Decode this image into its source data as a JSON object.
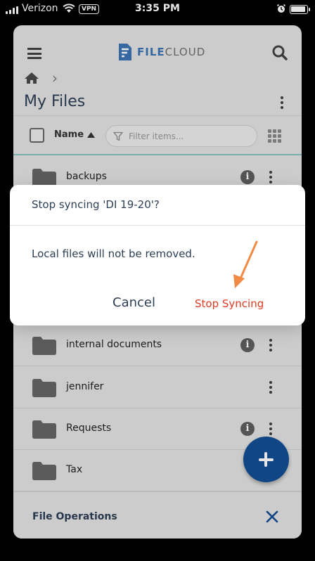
{
  "status_bar": {
    "carrier": "Verizon",
    "vpn": "VPN",
    "time": "3:35 PM"
  },
  "header": {
    "logo_prefix": "FILE",
    "logo_suffix": "CLOUD"
  },
  "breadcrumb": {
    "separator": "›"
  },
  "page_title": "My Files",
  "list_header": {
    "name_label": "Name",
    "filter_placeholder": "Filter items..."
  },
  "files": [
    {
      "name": "backups",
      "has_info": true
    },
    {
      "name": "internal documents",
      "has_info": true
    },
    {
      "name": "jennifer",
      "has_info": false
    },
    {
      "name": "Requests",
      "has_info": true
    },
    {
      "name": "Tax",
      "has_info": false
    }
  ],
  "file_operations": {
    "label": "File Operations"
  },
  "dialog": {
    "title": "Stop syncing 'DI 19-20'?",
    "message": "Local files will not be removed.",
    "cancel_label": "Cancel",
    "confirm_label": "Stop Syncing"
  },
  "colors": {
    "accent": "#134f93",
    "danger": "#e23b20",
    "annotation_arrow": "#f08a45"
  }
}
